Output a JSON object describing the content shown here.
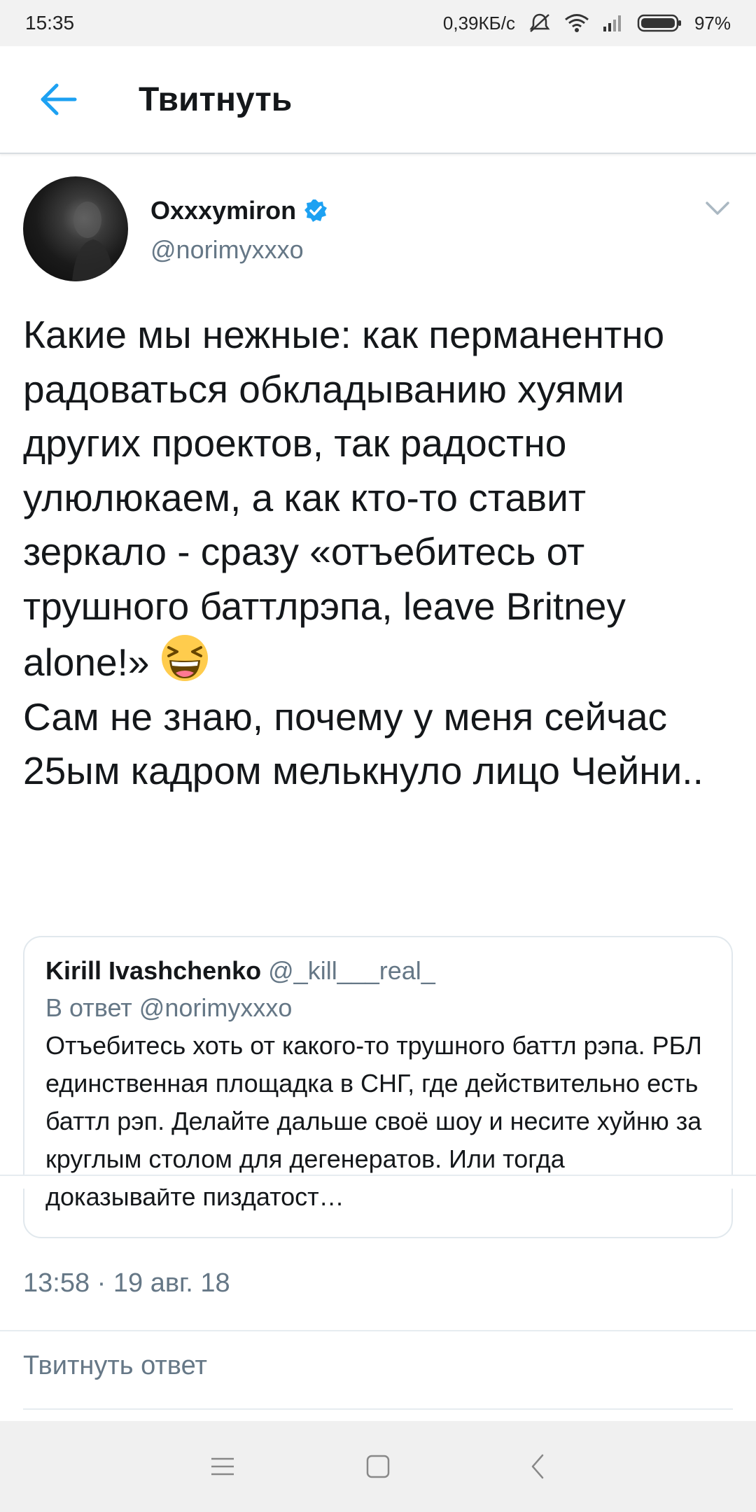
{
  "status_bar": {
    "time": "15:35",
    "net_speed": "0,39КБ/с",
    "battery": "97%",
    "icons": [
      "mute-icon",
      "wifi-icon",
      "signal-icon",
      "battery-icon"
    ]
  },
  "app_bar": {
    "title": "Твитнуть",
    "back_icon": "arrow-left-icon"
  },
  "tweet": {
    "author_name": "Oxxxymiron",
    "verified_icon": "verified-badge-icon",
    "handle": "@norimyxxxo",
    "text_lines": [
      "Какие мы нежные: как перманентно радоваться обкладыванию хуями других проектов, так радостно улюлюкаем, а как кто-то ставит зеркало - сразу «отъебитесь от трушного баттлрэпа, leave Britney alone!»",
      "Сам не знаю, почему у меня сейчас 25ым кадром мелькнуло лицо Чейни.."
    ],
    "emoji": "laughing-face-emoji",
    "timestamp": "13:58 · 19 авг. 18"
  },
  "quoted_tweet": {
    "name": "Kirill Ivashchenko",
    "handle": "@_kill___real_",
    "reply_to": "В ответ @norimyxxxo",
    "text": "Отъебитесь хоть от какого-то трушного баттл рэпа. РБЛ единственная площадка в СНГ, где действительно есть баттл рэп. Делайте дальше своё шоу и несите хуйню за круглым столом для дегенератов. Или тогда доказывайте пиздатост…"
  },
  "reply": {
    "placeholder": "Твитнуть ответ"
  },
  "colors": {
    "accent": "#1da1f2",
    "text": "#14171a",
    "secondary": "#657786",
    "border": "#e1e8ed"
  }
}
